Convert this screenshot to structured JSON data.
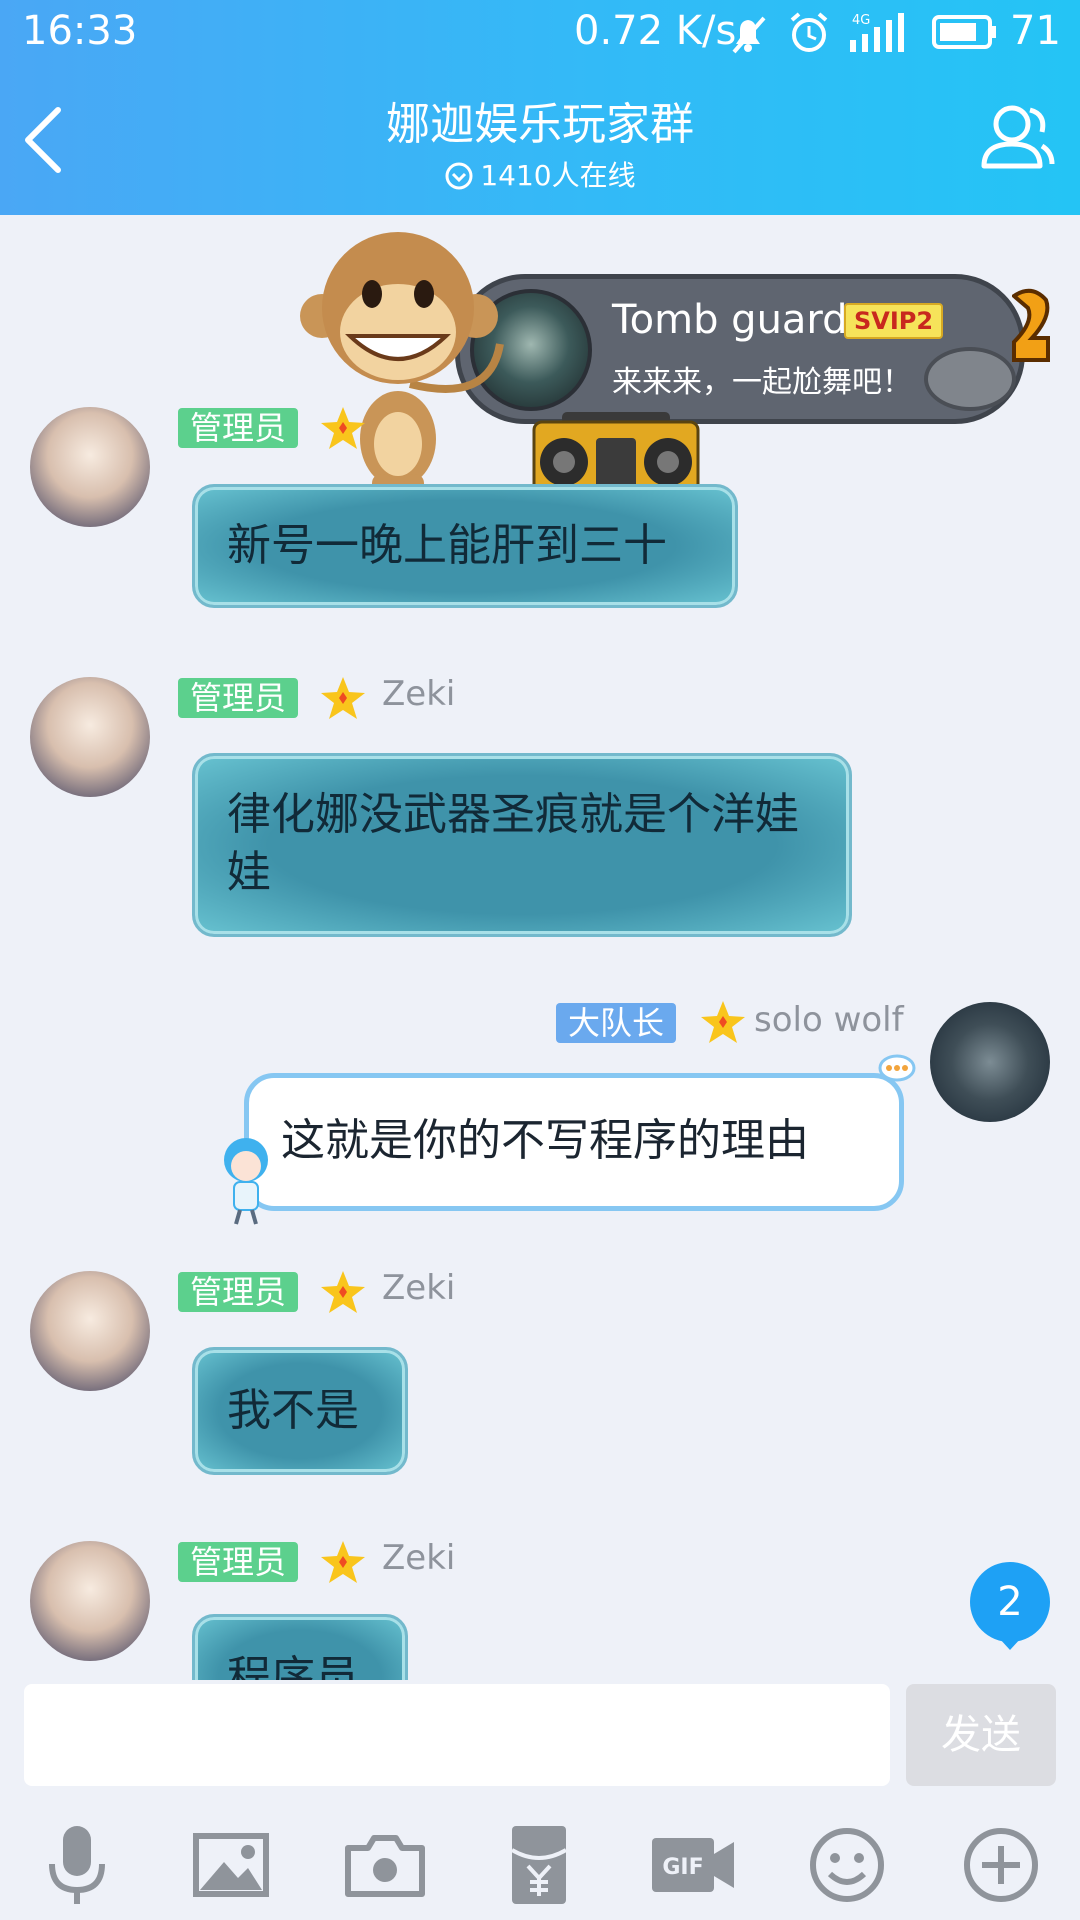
{
  "status_bar": {
    "time": "16:33",
    "speed": "0.72 K/s",
    "network": "4G",
    "battery": "71"
  },
  "header": {
    "title": "娜迦娱乐玩家群",
    "online": "1410人在线"
  },
  "banner": {
    "name": "Tomb guard",
    "vip": "SVIP2",
    "text": "来来来，一起尬舞吧！"
  },
  "messages": [
    {
      "side": "left",
      "badge": "管理员",
      "nick": "",
      "text": "新号一晚上能肝到三十"
    },
    {
      "side": "left",
      "badge": "管理员",
      "nick": "Zeki",
      "text": "律化娜没武器圣痕就是个洋娃娃"
    },
    {
      "side": "right",
      "badge": "大队长",
      "nick": "solo wolf",
      "text": "这就是你的不写程序的理由"
    },
    {
      "side": "left",
      "badge": "管理员",
      "nick": "Zeki",
      "text": "我不是"
    },
    {
      "side": "left",
      "badge": "管理员",
      "nick": "Zeki",
      "text": "程序员"
    }
  ],
  "unread_count": "2",
  "input": {
    "placeholder": "",
    "send_label": "发送"
  },
  "toolbar": [
    "microphone-icon",
    "image-icon",
    "camera-icon",
    "red-packet-icon",
    "gif-icon",
    "emoji-icon",
    "plus-icon"
  ],
  "colors": {
    "header_start": "#4aa7f5",
    "header_end": "#24c4f5",
    "admin_badge": "#5cd08d",
    "captain_badge": "#6aa9ee",
    "unread": "#1ea1f5"
  }
}
